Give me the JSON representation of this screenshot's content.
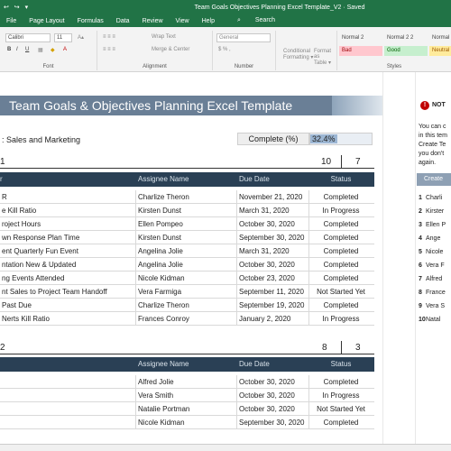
{
  "titlebar": {
    "quick_access": "↩ ↪ ▾",
    "title": "Team Goals Objectives Planning Excel Template_V2  ·  Saved"
  },
  "menu": [
    "File",
    "Page Layout",
    "Formulas",
    "Data",
    "Review",
    "View",
    "Help"
  ],
  "search": {
    "label": "Search",
    "icon": "search-icon"
  },
  "ribbon": {
    "font_name": "Calibri",
    "font_size": "11",
    "font_group": "Font",
    "alignment_group": "Alignment",
    "number_group": "Number",
    "styles_group": "Styles",
    "wrap_text": "Wrap Text",
    "merge_center": "Merge & Center",
    "number_format": "General",
    "conditional": "Conditional",
    "formatting": "Formatting ▾",
    "format_as": "Format as",
    "table": "Table ▾",
    "styles": [
      {
        "label": "Normal 2",
        "bg": "#ffffff"
      },
      {
        "label": "Normal 2 2",
        "bg": "#ffffff"
      },
      {
        "label": "Normal",
        "bg": "#ffffff"
      },
      {
        "label": "Bad",
        "bg": "#ffc7ce"
      },
      {
        "label": "Good",
        "bg": "#c6efce"
      },
      {
        "label": "Neutral",
        "bg": "#ffeb9c"
      }
    ]
  },
  "sheet": {
    "banner": "Team Goals & Objectives Planning Excel Template",
    "department": ": Sales and Marketing",
    "complete_label": "Complete (%)",
    "complete_value": "32.4%",
    "section1": {
      "num": "1",
      "total": "10",
      "count": "7"
    },
    "section2": {
      "num": "2",
      "total": "8",
      "count": "3"
    },
    "headers": {
      "assignee": "Assignee Name",
      "due": "Due Date",
      "status": "Status"
    },
    "rows1": [
      {
        "task": "R",
        "assignee": "Charlize Theron",
        "due": "November 21, 2020",
        "status": "Completed"
      },
      {
        "task": "e Kill Ratio",
        "assignee": "Kirsten Dunst",
        "due": "March 31, 2020",
        "status": "In Progress"
      },
      {
        "task": "roject Hours",
        "assignee": "Ellen Pompeo",
        "due": "October 30, 2020",
        "status": "Completed"
      },
      {
        "task": "wn Response Plan Time",
        "assignee": "Kirsten Dunst",
        "due": "September 30, 2020",
        "status": "Completed"
      },
      {
        "task": "ent Quarterly Fun Event",
        "assignee": "Angelina Jolie",
        "due": "March 31, 2020",
        "status": "Completed"
      },
      {
        "task": "ntation New & Updated",
        "assignee": "Angelina Jolie",
        "due": "October 30, 2020",
        "status": "Completed"
      },
      {
        "task": "ng Events Attended",
        "assignee": "Nicole Kidman",
        "due": "October 23, 2020",
        "status": "Completed"
      },
      {
        "task": "nt Sales to Project Team Handoff",
        "assignee": "Vera Farmiga",
        "due": "September 11, 2020",
        "status": "Not Started Yet"
      },
      {
        "task": "Past Due",
        "assignee": "Charlize Theron",
        "due": "September 19, 2020",
        "status": "Completed"
      },
      {
        "task": "Nerts Kill Ratio",
        "assignee": "Frances Conroy",
        "due": "January 2, 2020",
        "status": "In Progress"
      }
    ],
    "rows2": [
      {
        "task": "",
        "assignee": "Alfred Jolie",
        "due": "October 30, 2020",
        "status": "Completed"
      },
      {
        "task": "",
        "assignee": "Vera Smith",
        "due": "October 30, 2020",
        "status": "In Progress"
      },
      {
        "task": "",
        "assignee": "Natalie Portman",
        "due": "October 30, 2020",
        "status": "Not Started Yet"
      },
      {
        "task": "",
        "assignee": "Nicole Kidman",
        "due": "September 30, 2020",
        "status": "Completed"
      }
    ]
  },
  "side_panel": {
    "title": "NOT",
    "text": [
      "You can c",
      "in this tem",
      "Create Te",
      "you don't",
      "again."
    ],
    "button": "Create",
    "people": [
      {
        "n": "1",
        "name": "Charli"
      },
      {
        "n": "2",
        "name": "Kirster"
      },
      {
        "n": "3",
        "name": "Ellen P"
      },
      {
        "n": "4",
        "name": "Ange"
      },
      {
        "n": "5",
        "name": "Nicole"
      },
      {
        "n": "6",
        "name": "Vera F"
      },
      {
        "n": "7",
        "name": "Alfred"
      },
      {
        "n": "8",
        "name": "France"
      },
      {
        "n": "9",
        "name": "Vera S"
      },
      {
        "n": "10",
        "name": "Natal"
      }
    ]
  }
}
